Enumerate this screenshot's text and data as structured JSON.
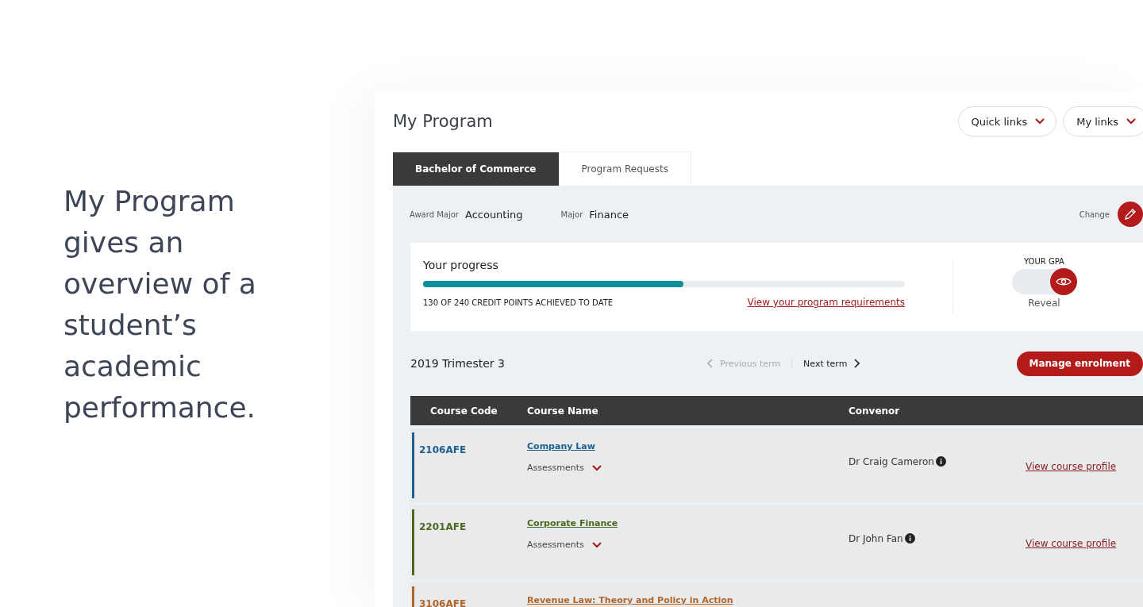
{
  "caption": "My Program gives an overview of a student’s academic performance.",
  "page": {
    "title": "My Program"
  },
  "header_links": [
    {
      "label": "Quick links"
    },
    {
      "label": "My links"
    }
  ],
  "tabs": [
    {
      "label": "Bachelor of Commerce",
      "selected": true
    },
    {
      "label": "Program Requests",
      "selected": false
    }
  ],
  "majors": [
    {
      "label": "Award Major",
      "value": "Accounting"
    },
    {
      "label": "Major",
      "value": "Finance"
    }
  ],
  "change": {
    "label": "Change"
  },
  "progress": {
    "title": "Your progress",
    "level": 0.54,
    "summary": "130 OF 240 CREDIT POINTS ACHIEVED TO DATE",
    "link": "View your program requirements"
  },
  "gpa": {
    "title": "YOUR GPA",
    "on": true,
    "action": "Reveal"
  },
  "term": {
    "title": "2019 Trimester 3",
    "nav": [
      {
        "label": "Previous term",
        "kind": "previous",
        "disabled": true
      },
      {
        "label": "Next term",
        "kind": "next",
        "disabled": false
      }
    ],
    "action": "Manage enrolment"
  },
  "table": {
    "columns": [
      "Course Code",
      "Course Name",
      "Convenor"
    ],
    "rows": [
      {
        "code": "2106AFE",
        "name": "Company Law",
        "assessments": "Assessments",
        "convenor": "Dr Craig Cameron",
        "link": "View course profile",
        "color": "#1d5f8f"
      },
      {
        "code": "2201AFE",
        "name": "Corporate Finance",
        "assessments": "Assessments",
        "convenor": "Dr John Fan",
        "link": "View course profile",
        "color": "#4b6a1f"
      },
      {
        "code": "3106AFE",
        "name": "Revenue Law: Theory and Policy in Action",
        "color": "#b0662a"
      }
    ]
  }
}
